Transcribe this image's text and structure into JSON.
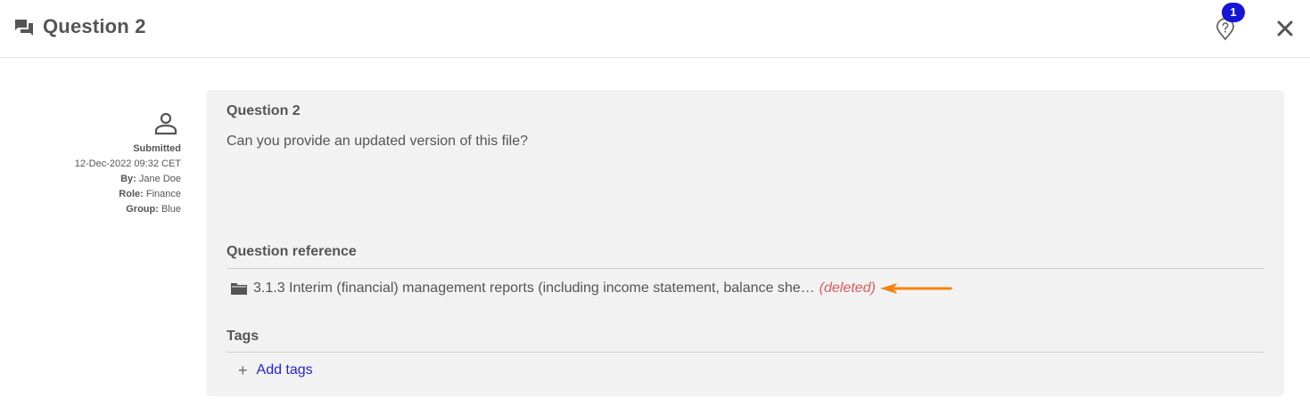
{
  "header": {
    "title": "Question 2",
    "help_badge_count": "1",
    "icons": {
      "title": "forum-icon",
      "help": "help-marker-icon",
      "close": "close-icon"
    }
  },
  "submitter": {
    "status": "Submitted",
    "timestamp": "12-Dec-2022 09:32 CET",
    "by_label": "By:",
    "by_value": "Jane Doe",
    "role_label": "Role:",
    "role_value": "Finance",
    "group_label": "Group:",
    "group_value": "Blue",
    "avatar_icon": "person-icon"
  },
  "question": {
    "title": "Question 2",
    "body": "Can you provide an updated version of this file?"
  },
  "reference": {
    "section_title": "Question reference",
    "text": "3.1.3 Interim (financial) management reports (including income statement, balance she…",
    "deleted_label": "(deleted)",
    "icon": "folder-icon",
    "annotation_icon": "arrow-left-icon"
  },
  "tags": {
    "section_title": "Tags",
    "add_label": "Add tags"
  },
  "colors": {
    "accent": "#2424d8",
    "badge": "#1515d6",
    "deleted": "#e05a5a",
    "arrow": "#f5820f",
    "card_bg": "#f2f2f2"
  }
}
